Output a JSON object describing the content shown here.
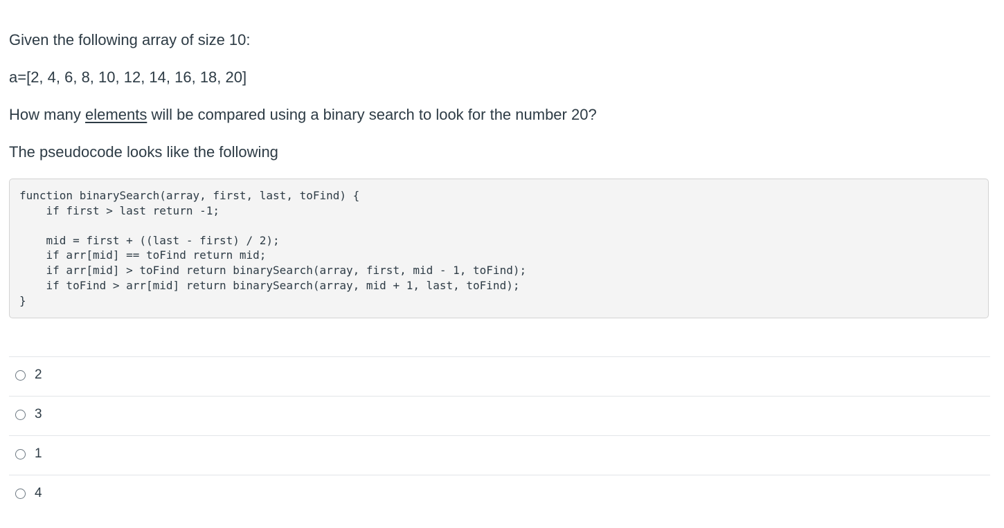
{
  "question": {
    "line1": "Given the following array of size 10:",
    "line2": "a=[2, 4, 6, 8, 10, 12, 14, 16, 18, 20]",
    "line3_before": "How many ",
    "line3_underlined": "elements",
    "line3_after": " will be compared using a binary search to look for the number 20?",
    "line4": "The pseudocode looks like the following"
  },
  "code": {
    "lines": [
      "function binarySearch(array, first, last, toFind) {",
      "    if first > last return -1;",
      "",
      "    mid = first + ((last - first) / 2);",
      "    if arr[mid] == toFind return mid;",
      "    if arr[mid] > toFind return binarySearch(array, first, mid - 1, toFind);",
      "    if toFind > arr[mid] return binarySearch(array, mid + 1, last, toFind);",
      "}"
    ]
  },
  "answers": [
    {
      "label": "2",
      "selected": false
    },
    {
      "label": "3",
      "selected": false
    },
    {
      "label": "1",
      "selected": false
    },
    {
      "label": "4",
      "selected": false
    }
  ]
}
